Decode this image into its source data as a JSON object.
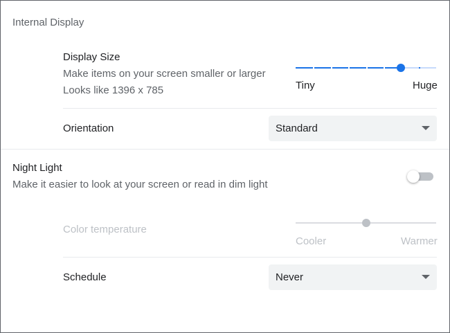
{
  "internal_display": {
    "title": "Internal Display",
    "display_size": {
      "label": "Display Size",
      "description": "Make items on your screen smaller or larger",
      "looks_like": "Looks like 1396 x 785",
      "min_label": "Tiny",
      "max_label": "Huge",
      "value_fraction": 0.75,
      "tick_count": 9
    },
    "orientation": {
      "label": "Orientation",
      "selected": "Standard"
    }
  },
  "night_light": {
    "title": "Night Light",
    "description": "Make it easier to look at your screen or read in dim light",
    "enabled": false,
    "color_temperature": {
      "label": "Color temperature",
      "min_label": "Cooler",
      "max_label": "Warmer",
      "value_fraction": 0.5
    },
    "schedule": {
      "label": "Schedule",
      "selected": "Never"
    }
  },
  "colors": {
    "accent": "#1a73e8",
    "disabled": "#bdc1c6",
    "divider": "#e8eaed"
  }
}
